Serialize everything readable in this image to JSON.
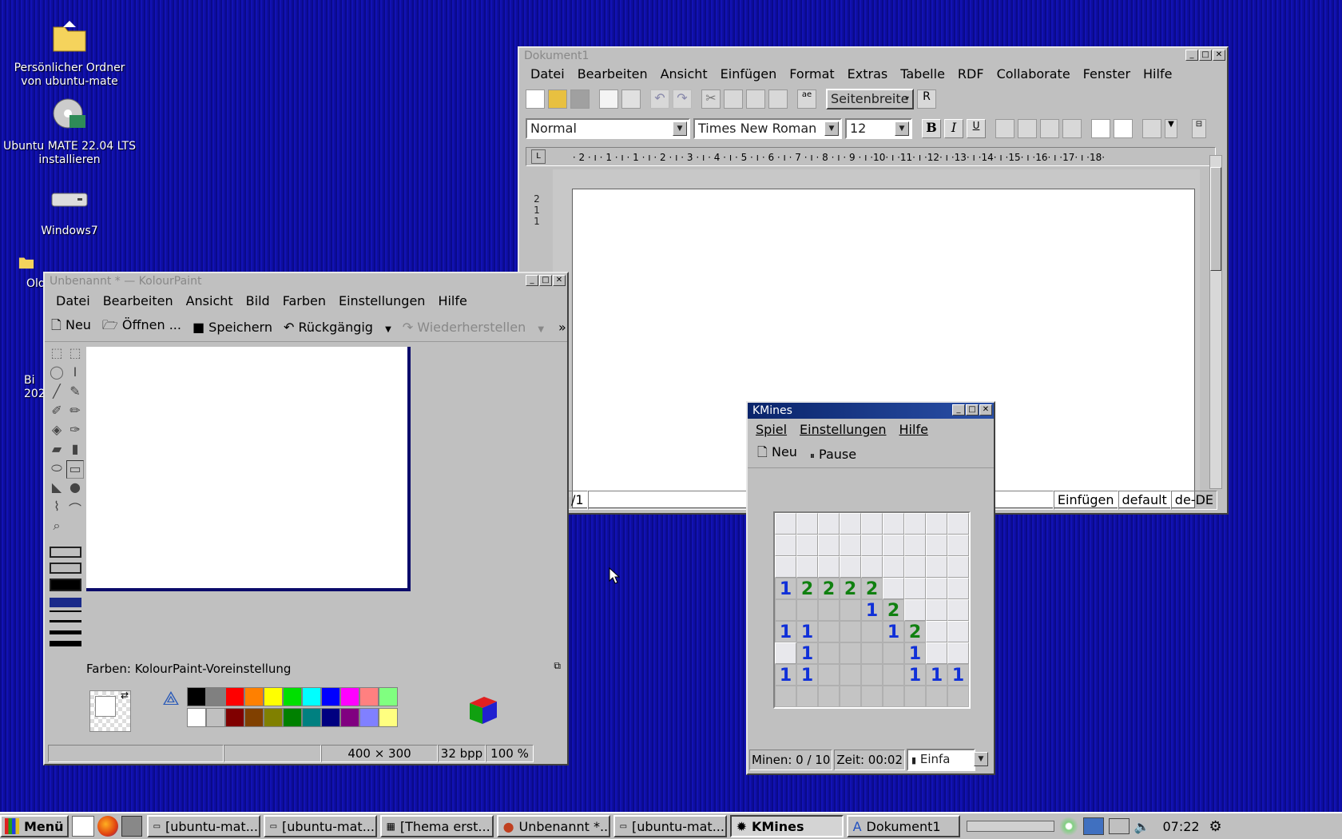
{
  "desktop": {
    "icons": [
      {
        "label": "Persönlicher Ordner von ubuntu-mate"
      },
      {
        "label": "Ubuntu MATE 22.04 LTS installieren"
      },
      {
        "label": "Windows7"
      },
      {
        "label": "Old"
      },
      {
        "label": "Bi 202"
      }
    ]
  },
  "writer": {
    "title": "Dokument1",
    "menu": [
      "Datei",
      "Bearbeiten",
      "Ansicht",
      "Einfügen",
      "Format",
      "Extras",
      "Tabelle",
      "RDF",
      "Collaborate",
      "Fenster",
      "Hilfe"
    ],
    "zoom_mode": "Seitenbreite",
    "style": "Normal",
    "font": "Times New Roman",
    "size": "12",
    "bold": "B",
    "italic": "I",
    "underline": "U",
    "ruler": "· 2 · ı · 1 · ı · 1 · ı · 2 · ı · 3 · ı · 4 · ı · 5 · ı · 6 · ı · 7 · ı · 8 · ı · 9 · ı ·10· ı ·11· ı ·12· ı ·13· ı ·14· ı ·15· ı ·16· ı ·17· ı ·18·",
    "vruler": "2\n1\n1",
    "status": {
      "page": "/1",
      "mode": "Einfügen",
      "style": "default",
      "lang": "de-DE"
    }
  },
  "kolour": {
    "title": "Unbenannt * — KolourPaint",
    "menu": [
      "Datei",
      "Bearbeiten",
      "Ansicht",
      "Bild",
      "Farben",
      "Einstellungen",
      "Hilfe"
    ],
    "toolbar": {
      "new": "Neu",
      "open": "Öffnen ...",
      "save": "Speichern",
      "undo": "Rückgängig",
      "redo": "Wiederherstellen",
      "more": "»"
    },
    "colors_label": "Farben: KolourPaint-Voreinstellung",
    "palette_top": [
      "#000000",
      "#808080",
      "#ff0000",
      "#ff8000",
      "#ffff00",
      "#00e000",
      "#00ffff",
      "#0000ff",
      "#ff00ff",
      "#ff8080",
      "#80ff80"
    ],
    "palette_bottom": [
      "#ffffff",
      "#c0c0c0",
      "#800000",
      "#804000",
      "#808000",
      "#008000",
      "#008080",
      "#000080",
      "#800080",
      "#8080ff",
      "#ffff80"
    ],
    "status": {
      "size": "400 × 300",
      "depth": "32 bpp",
      "zoom": "100 %"
    }
  },
  "kmines": {
    "title": "KMines",
    "menu": [
      "Spiel",
      "Einstellungen",
      "Hilfe"
    ],
    "toolbar": {
      "new": "Neu",
      "pause": "Pause"
    },
    "board": [
      [
        "c",
        "c",
        "c",
        "c",
        "c",
        "c",
        "c",
        "c",
        "c"
      ],
      [
        "c",
        "c",
        "c",
        "c",
        "c",
        "c",
        "c",
        "c",
        "c"
      ],
      [
        "c",
        "c",
        "c",
        "c",
        "c",
        "c",
        "c",
        "c",
        "c"
      ],
      [
        "1",
        "2",
        "2",
        "2",
        "2",
        "c",
        "c",
        "c",
        "c"
      ],
      [
        "r",
        "r",
        "r",
        "r",
        "1",
        "2",
        "c",
        "c",
        "c"
      ],
      [
        "1",
        "1",
        "r",
        "r",
        "r",
        "1",
        "2",
        "c",
        "c"
      ],
      [
        "c",
        "1",
        "r",
        "r",
        "r",
        "r",
        "1",
        "c",
        "c"
      ],
      [
        "1",
        "1",
        "r",
        "r",
        "r",
        "r",
        "1",
        "1",
        "1"
      ],
      [
        "r",
        "r",
        "r",
        "r",
        "r",
        "r",
        "r",
        "r",
        "r"
      ]
    ],
    "status": {
      "mines": "Minen: 0 / 10",
      "time": "Zeit: 00:02",
      "level": "Einfa"
    }
  },
  "taskbar": {
    "menu": "Menü",
    "tasks": [
      "[ubuntu-mat...",
      "[ubuntu-mat...",
      "[Thema erst...",
      "Unbenannt *...",
      "[ubuntu-mat...",
      "KMines",
      "Dokument1"
    ],
    "clock": "07:22"
  }
}
